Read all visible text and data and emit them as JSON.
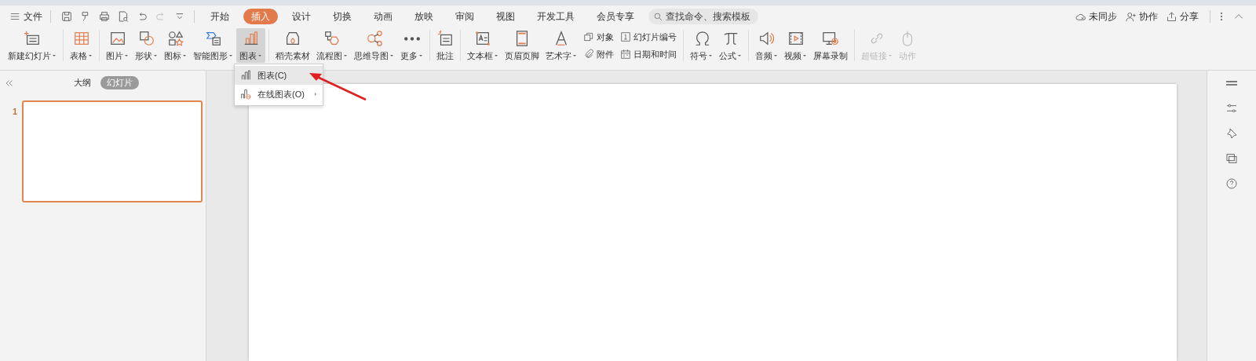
{
  "menu_bar": {
    "file_menu": "文件",
    "tabs": [
      {
        "label": "开始",
        "selected": false
      },
      {
        "label": "插入",
        "selected": true
      },
      {
        "label": "设计",
        "selected": false
      },
      {
        "label": "切换",
        "selected": false
      },
      {
        "label": "动画",
        "selected": false
      },
      {
        "label": "放映",
        "selected": false
      },
      {
        "label": "审阅",
        "selected": false
      },
      {
        "label": "视图",
        "selected": false
      },
      {
        "label": "开发工具",
        "selected": false
      },
      {
        "label": "会员专享",
        "selected": false
      }
    ],
    "search": {
      "placeholder": "查找命令、搜索模板"
    },
    "right_actions": [
      "未同步",
      "协作",
      "分享"
    ]
  },
  "ribbon": {
    "groups": [
      {
        "items": [
          {
            "kind": "large",
            "label": "新建幻灯片",
            "dropdown": true,
            "selected": false,
            "disabled": false
          }
        ]
      },
      {
        "items": [
          {
            "kind": "large",
            "label": "表格",
            "dropdown": true,
            "selected": false,
            "disabled": false
          }
        ]
      },
      {
        "items": [
          {
            "kind": "large",
            "label": "图片",
            "dropdown": true,
            "selected": false,
            "disabled": false
          },
          {
            "kind": "large",
            "label": "形状",
            "dropdown": true,
            "selected": false,
            "disabled": false
          },
          {
            "kind": "large",
            "label": "图标",
            "dropdown": true,
            "selected": false,
            "disabled": false
          },
          {
            "kind": "large",
            "label": "智能图形",
            "dropdown": true,
            "selected": false,
            "disabled": false
          },
          {
            "kind": "large",
            "label": "图表",
            "dropdown": true,
            "selected": true,
            "disabled": false
          }
        ]
      },
      {
        "items": [
          {
            "kind": "large",
            "label": "稻壳素材",
            "dropdown": false,
            "selected": false,
            "disabled": false
          },
          {
            "kind": "large",
            "label": "流程图",
            "dropdown": true,
            "selected": false,
            "disabled": false
          },
          {
            "kind": "large",
            "label": "思维导图",
            "dropdown": true,
            "selected": false,
            "disabled": false
          },
          {
            "kind": "large",
            "label": "更多",
            "dropdown": true,
            "selected": false,
            "disabled": false
          }
        ]
      },
      {
        "items": [
          {
            "kind": "large",
            "label": "批注",
            "dropdown": false,
            "selected": false,
            "disabled": false
          }
        ]
      },
      {
        "items": [
          {
            "kind": "large",
            "label": "文本框",
            "dropdown": true,
            "selected": false,
            "disabled": false
          },
          {
            "kind": "large",
            "label": "页眉页脚",
            "dropdown": false,
            "selected": false,
            "disabled": false
          },
          {
            "kind": "large",
            "label": "艺术字",
            "dropdown": true,
            "selected": false,
            "disabled": false
          },
          {
            "kind": "small",
            "label": "对象",
            "dropdown": false,
            "selected": false,
            "disabled": false
          },
          {
            "kind": "small",
            "label": "附件",
            "dropdown": false,
            "selected": false,
            "disabled": false
          },
          {
            "kind": "small",
            "label": "幻灯片编号",
            "dropdown": false,
            "selected": false,
            "disabled": false
          },
          {
            "kind": "small",
            "label": "日期和时间",
            "dropdown": false,
            "selected": false,
            "disabled": false
          }
        ]
      },
      {
        "items": [
          {
            "kind": "large",
            "label": "符号",
            "dropdown": true,
            "selected": false,
            "disabled": false
          },
          {
            "kind": "large",
            "label": "公式",
            "dropdown": true,
            "selected": false,
            "disabled": false
          }
        ]
      },
      {
        "items": [
          {
            "kind": "large",
            "label": "音频",
            "dropdown": true,
            "selected": false,
            "disabled": false
          },
          {
            "kind": "large",
            "label": "视频",
            "dropdown": true,
            "selected": false,
            "disabled": false
          },
          {
            "kind": "large",
            "label": "屏幕录制",
            "dropdown": false,
            "selected": false,
            "disabled": false
          }
        ]
      },
      {
        "items": [
          {
            "kind": "large",
            "label": "超链接",
            "dropdown": true,
            "selected": false,
            "disabled": true
          },
          {
            "kind": "large",
            "label": "动作",
            "dropdown": false,
            "selected": false,
            "disabled": true
          }
        ]
      }
    ]
  },
  "chart_menu": {
    "items": [
      {
        "label": "图表(C)",
        "selected": true,
        "submenu": false
      },
      {
        "label": "在线图表(O)",
        "selected": false,
        "submenu": true
      }
    ]
  },
  "side_panel": {
    "tabs": [
      {
        "label": "大纲",
        "selected": false
      },
      {
        "label": "幻灯片",
        "selected": true
      }
    ],
    "slides": [
      {
        "number": "1",
        "selected": true
      }
    ]
  }
}
